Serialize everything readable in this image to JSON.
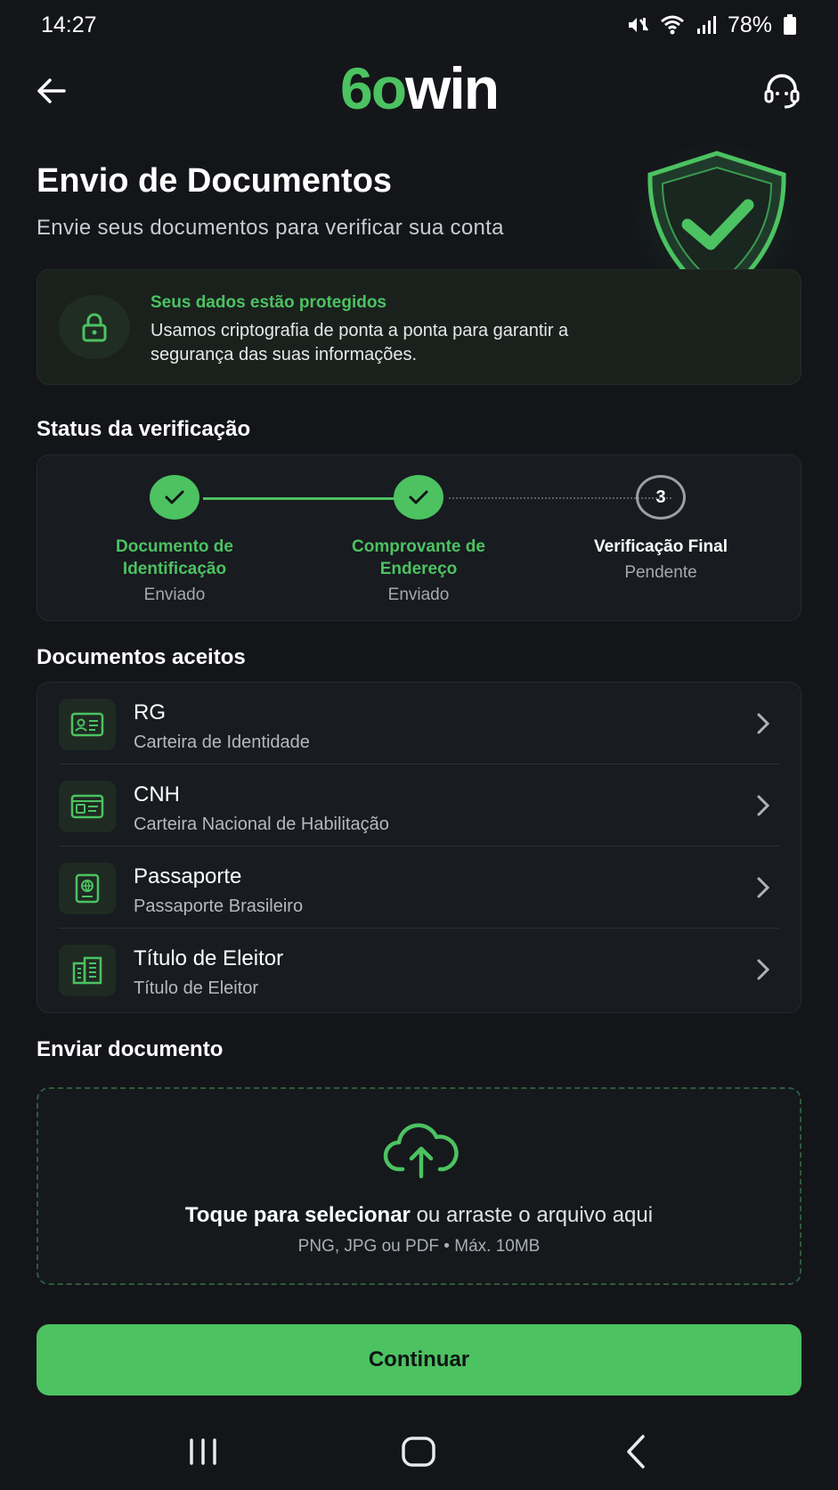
{
  "status_bar": {
    "time": "14:27",
    "battery": "78%"
  },
  "header": {
    "logo_part1": "6o",
    "logo_part2": "win",
    "icons": [
      "arrow-left-icon",
      "headset-icon"
    ]
  },
  "page": {
    "title": "Envio de Documentos",
    "subtitle": "Envie seus documentos para verificar sua conta"
  },
  "security_notice": {
    "title": "Seus dados estão protegidos",
    "text": "Usamos criptografia de ponta a ponta para garantir a segurança das suas informações."
  },
  "verification": {
    "section_title": "Status da verificação",
    "steps": [
      {
        "label": "Documento de Identificação",
        "status": "Enviado",
        "state": "done"
      },
      {
        "label": "Comprovante de Endereço",
        "status": "Enviado",
        "state": "done"
      },
      {
        "number": "3",
        "label": "Verificação Final",
        "status": "Pendente",
        "state": "pending"
      }
    ]
  },
  "documents": {
    "section_title": "Documentos aceitos",
    "items": [
      {
        "name": "RG",
        "description": "Carteira de Identidade",
        "icon": "id-card-icon"
      },
      {
        "name": "CNH",
        "description": "Carteira Nacional de Habilitação",
        "icon": "driver-license-icon"
      },
      {
        "name": "Passaporte",
        "description": "Passaporte Brasileiro",
        "icon": "passport-icon"
      },
      {
        "name": "Título de Eleitor",
        "description": "Título de Eleitor",
        "icon": "voter-card-icon"
      }
    ]
  },
  "upload": {
    "section_title": "Enviar documento",
    "action_bold": "Toque para selecionar",
    "action_rest": " ou arraste o arquivo aqui",
    "hint": "PNG, JPG ou PDF • Máx. 10MB"
  },
  "continue_button": "Continuar",
  "colors": {
    "accent": "#4cc261",
    "background": "#131519",
    "card": "#181b20"
  }
}
